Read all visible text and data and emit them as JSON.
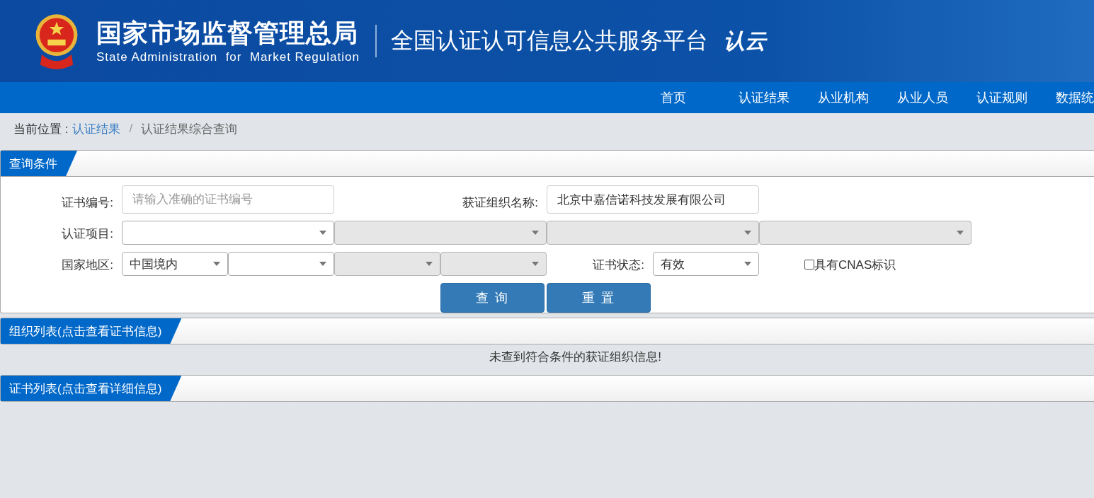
{
  "header": {
    "agency_name": "国家市场监督管理总局",
    "agency_name_en": "State Administration  for  Market Regulation",
    "platform_title": "全国认证认可信息公共服务平台",
    "logo_text": "认云"
  },
  "nav": {
    "items": [
      {
        "label": "首页"
      },
      {
        "label": "认证结果"
      },
      {
        "label": "从业机构"
      },
      {
        "label": "从业人员"
      },
      {
        "label": "认证规则"
      },
      {
        "label": "数据统"
      }
    ]
  },
  "breadcrumb": {
    "label": "当前位置 :",
    "separator": "/",
    "items": [
      {
        "label": "认证结果",
        "kind": "link"
      },
      {
        "label": "认证结果综合查询",
        "kind": "current"
      }
    ]
  },
  "query": {
    "title": "查询条件",
    "cert_no": {
      "label": "证书编号:",
      "placeholder": "请输入准确的证书编号"
    },
    "org_name": {
      "label": "获证组织名称:",
      "value": "北京中嘉信诺科技发展有限公司"
    },
    "project": {
      "label": "认证项目:",
      "selects": [
        {
          "disabled": false
        },
        {
          "disabled": true
        },
        {
          "disabled": true
        },
        {
          "disabled": true
        }
      ]
    },
    "region": {
      "label": "国家地区:",
      "selects": [
        {
          "value": "中国境内",
          "disabled": false
        },
        {
          "disabled": false
        },
        {
          "disabled": true
        },
        {
          "disabled": true
        }
      ]
    },
    "status": {
      "label": "证书状态:",
      "value": "有效"
    },
    "cnas": {
      "label": "具有CNAS标识",
      "checked": false
    },
    "buttons": [
      {
        "label": "查 询"
      },
      {
        "label": "重 置"
      }
    ]
  },
  "org_list": {
    "title": "组织列表(点击查看证书信息)",
    "message": "未查到符合条件的获证组织信息!"
  },
  "cert_list": {
    "title": "证书列表(点击查看详细信息)"
  }
}
